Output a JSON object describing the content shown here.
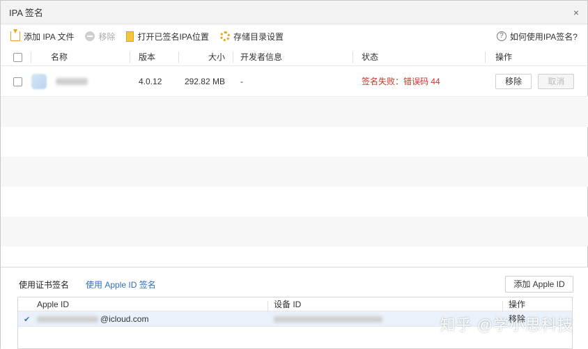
{
  "window": {
    "title": "IPA 签名",
    "close_glyph": "×"
  },
  "toolbar": {
    "add_label": "添加 IPA 文件",
    "remove_label": "移除",
    "open_folder_label": "打开已签名IPA位置",
    "storage_settings_label": "存储目录设置",
    "help_label": "如何使用IPA签名?"
  },
  "table": {
    "columns": {
      "name": "名称",
      "version": "版本",
      "size": "大小",
      "developer": "开发者信息",
      "status": "状态",
      "actions": "操作"
    },
    "rows": [
      {
        "version": "4.0.12",
        "size": "292.82 MB",
        "developer": "-",
        "status": "签名失败：错误码 44",
        "remove_button": "移除",
        "cancel_button": "取消"
      }
    ]
  },
  "bottom": {
    "tab_cert": "使用证书签名",
    "tab_apple_id": "使用 Apple ID 签名",
    "add_apple_id_button": "添加 Apple ID",
    "accounts": {
      "columns": {
        "apple_id": "Apple ID",
        "device_id": "设备 ID",
        "actions": "操作"
      },
      "rows": [
        {
          "apple_id_suffix": "@icloud.com",
          "action": "移除"
        }
      ]
    }
  },
  "watermark": "知乎 @学小思科技",
  "colors": {
    "status_fail": "#c0392b",
    "link": "#2f6fbf",
    "toolbar_icon": "#e6a817"
  }
}
